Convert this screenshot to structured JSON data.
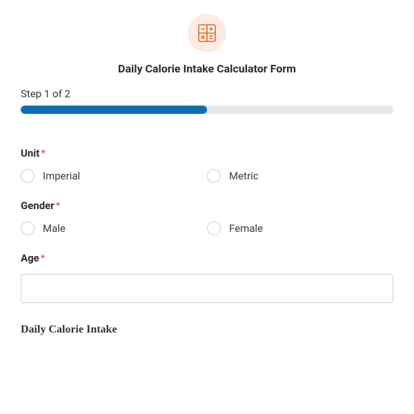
{
  "header": {
    "title": "Daily Calorie Intake Calculator Form",
    "icon": "calculator-icon"
  },
  "progress": {
    "step_label": "Step 1 of 2",
    "percent": 50
  },
  "fields": {
    "unit": {
      "label": "Unit",
      "required_mark": "*",
      "options": [
        "Imperial",
        "Metric"
      ]
    },
    "gender": {
      "label": "Gender",
      "required_mark": "*",
      "options": [
        "Male",
        "Female"
      ]
    },
    "age": {
      "label": "Age",
      "required_mark": "*",
      "value": ""
    }
  },
  "section": {
    "heading": "Daily Calorie Intake"
  },
  "colors": {
    "accent": "#0d6fb8",
    "icon_bg": "#fcebe2",
    "icon_stroke": "#d96b2b",
    "required": "#d9534f"
  }
}
